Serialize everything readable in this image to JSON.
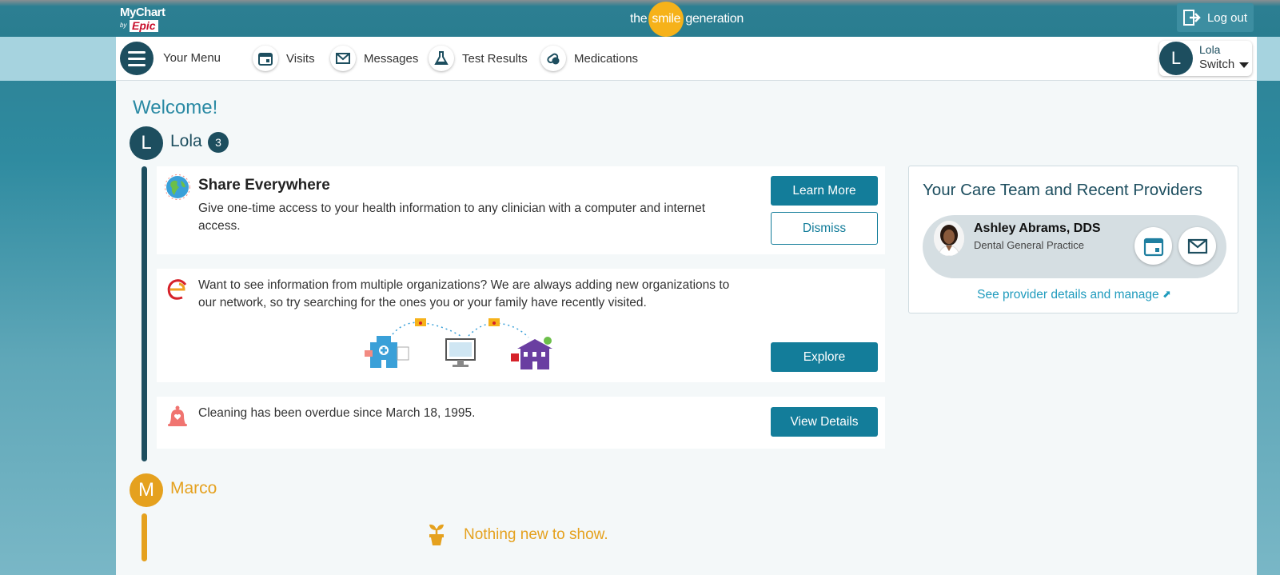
{
  "header": {
    "mychart_logo": "MyChart",
    "mychart_by": "by",
    "mychart_epic": "Epic",
    "brand_the": "the",
    "brand_smile": "smile",
    "brand_generation": "generation",
    "logout_label": "Log out"
  },
  "nav": {
    "menu_label": "Your Menu",
    "items": [
      {
        "label": "Visits",
        "icon": "calendar-icon"
      },
      {
        "label": "Messages",
        "icon": "envelope-icon"
      },
      {
        "label": "Test Results",
        "icon": "flask-icon"
      },
      {
        "label": "Medications",
        "icon": "pills-icon"
      }
    ],
    "switcher": {
      "initial": "L",
      "name": "Lola",
      "label": "Switch"
    }
  },
  "welcome": "Welcome!",
  "people": [
    {
      "initial": "L",
      "name": "Lola",
      "badge": "3",
      "color": "#1d4e5f",
      "cards": [
        {
          "title": "Share Everywhere",
          "text": "Give one-time access to your health information to any clinician with a computer and internet access.",
          "primary_button": "Learn More",
          "secondary_button": "Dismiss",
          "icon": "globe-icon"
        },
        {
          "text": "Want to see information from multiple organizations? We are always adding new organizations to our network, so try searching for the ones you or your family have recently visited.",
          "primary_button": "Explore",
          "icon": "epic-e-icon"
        },
        {
          "text": "Cleaning has been overdue since March 18, 1995.",
          "primary_button": "View Details",
          "icon": "bell-icon"
        }
      ]
    },
    {
      "initial": "M",
      "name": "Marco",
      "color": "#e5a11e",
      "empty_text": "Nothing new to show."
    }
  ],
  "care_team": {
    "title": "Your Care Team and Recent Providers",
    "provider": {
      "name": "Ashley Abrams, DDS",
      "specialty": "Dental General Practice"
    },
    "link": "See provider details and manage"
  }
}
